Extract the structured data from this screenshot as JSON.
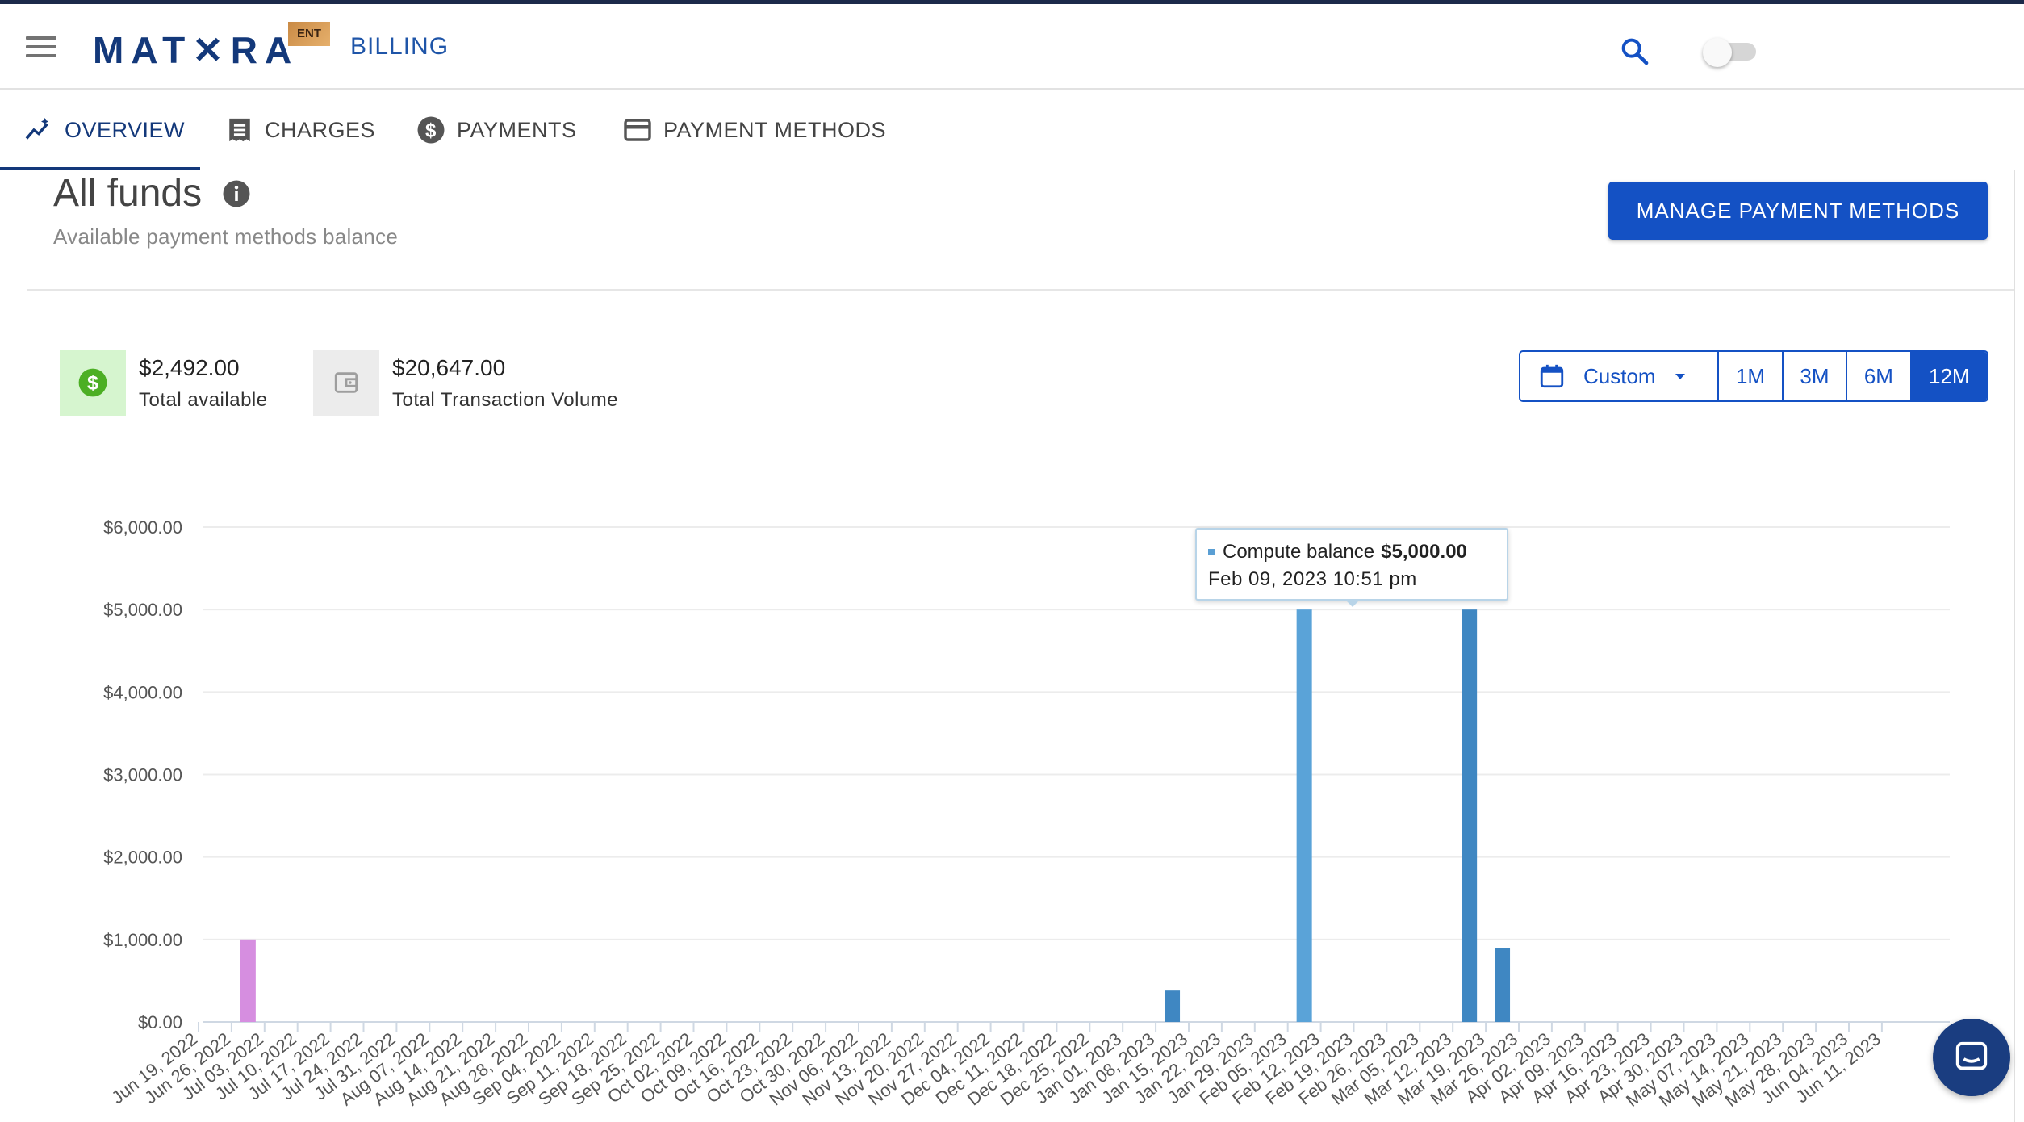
{
  "header": {
    "logo": "MAT✕RA",
    "logo_badge": "ENT",
    "section": "BILLING",
    "menu_icon": "hamburger-menu-icon",
    "search_icon": "search-icon",
    "theme_toggle": "off"
  },
  "tabs": [
    {
      "label": "OVERVIEW",
      "icon": "insights-icon",
      "active": true
    },
    {
      "label": "CHARGES",
      "icon": "receipt-icon",
      "active": false
    },
    {
      "label": "PAYMENTS",
      "icon": "dollar-circle-icon",
      "active": false
    },
    {
      "label": "PAYMENT METHODS",
      "icon": "credit-card-icon",
      "active": false
    }
  ],
  "funds": {
    "title": "All funds",
    "subtitle": "Available payment methods balance",
    "manage_button": "MANAGE PAYMENT METHODS"
  },
  "stats": [
    {
      "value": "$2,492.00",
      "label": "Total available",
      "icon": "dollar-circle-icon",
      "color": "#4caf24"
    },
    {
      "value": "$20,647.00",
      "label": "Total Transaction Volume",
      "icon": "wallet-icon",
      "color": "#9e9e9e"
    }
  ],
  "range": {
    "custom_label": "Custom",
    "options": [
      "1M",
      "3M",
      "6M",
      "12M"
    ],
    "selected": "12M"
  },
  "tooltip": {
    "series": "Compute balance",
    "value": "$5,000.00",
    "date": "Feb 09, 2023 10:51 pm"
  },
  "colors": {
    "primary": "#1451c4",
    "navy": "#13387a",
    "bar_blue": "#3f87c2",
    "bar_blue_highlight": "#5aa3d8",
    "bar_pink": "#d68ee0"
  },
  "chart_data": {
    "type": "bar",
    "ylim": [
      0,
      6000
    ],
    "yticks": [
      "$0.00",
      "$1,000.00",
      "$2,000.00",
      "$3,000.00",
      "$4,000.00",
      "$5,000.00",
      "$6,000.00"
    ],
    "categories": [
      "Jun 19, 2022",
      "Jun 26, 2022",
      "Jul 03, 2022",
      "Jul 10, 2022",
      "Jul 17, 2022",
      "Jul 24, 2022",
      "Jul 31, 2022",
      "Aug 07, 2022",
      "Aug 14, 2022",
      "Aug 21, 2022",
      "Aug 28, 2022",
      "Sep 04, 2022",
      "Sep 11, 2022",
      "Sep 18, 2022",
      "Sep 25, 2022",
      "Oct 02, 2022",
      "Oct 09, 2022",
      "Oct 16, 2022",
      "Oct 23, 2022",
      "Oct 30, 2022",
      "Nov 06, 2022",
      "Nov 13, 2022",
      "Nov 20, 2022",
      "Nov 27, 2022",
      "Dec 04, 2022",
      "Dec 11, 2022",
      "Dec 18, 2022",
      "Dec 25, 2022",
      "Jan 01, 2023",
      "Jan 08, 2023",
      "Jan 15, 2023",
      "Jan 22, 2023",
      "Jan 29, 2023",
      "Feb 05, 2023",
      "Feb 12, 2023",
      "Feb 19, 2023",
      "Feb 26, 2023",
      "Mar 05, 2023",
      "Mar 12, 2023",
      "Mar 19, 2023",
      "Mar 26, 2023",
      "Apr 02, 2023",
      "Apr 09, 2023",
      "Apr 16, 2023",
      "Apr 23, 2023",
      "Apr 30, 2023",
      "May 07, 2023",
      "May 14, 2023",
      "May 21, 2023",
      "May 28, 2023",
      "Jun 04, 2023",
      "Jun 11, 2023"
    ],
    "bars": [
      {
        "category": "Jun 26, 2022",
        "value": 1000,
        "color": "#d68ee0"
      },
      {
        "category": "Jan 08, 2023",
        "value": 380,
        "color": "#3f87c2"
      },
      {
        "category": "Feb 05, 2023",
        "value": 5000,
        "color": "#5aa3d8",
        "highlight": true
      },
      {
        "category": "Mar 12, 2023",
        "value": 5000,
        "color": "#3f87c2"
      },
      {
        "category": "Mar 19, 2023",
        "value": 900,
        "color": "#3f87c2"
      }
    ],
    "grid": true
  }
}
